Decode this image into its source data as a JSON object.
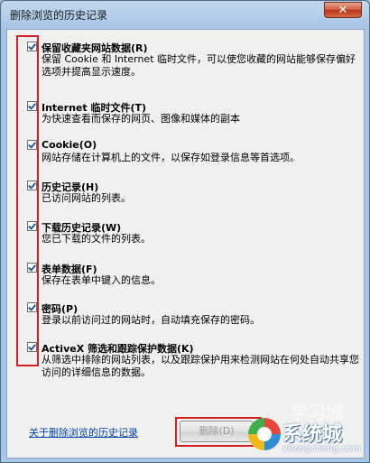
{
  "window": {
    "title": "删除浏览的历史记录",
    "close_label": "✕"
  },
  "items": [
    {
      "checked": true,
      "title": "保留收藏夹网站数据(R)",
      "desc": "保留 Cookie 和 Internet 临时文件，可以使您收藏的网站能够保存偏好选项并提高显示速度。"
    },
    {
      "checked": true,
      "title": "Internet 临时文件(T)",
      "desc": "为快速查看而保存的网页、图像和媒体的副本"
    },
    {
      "checked": true,
      "title": "Cookie(O)",
      "desc": "网站存储在计算机上的文件，以保存如登录信息等首选项。"
    },
    {
      "checked": true,
      "title": "历史记录(H)",
      "desc": "已访问网站的列表。"
    },
    {
      "checked": true,
      "title": "下载历史记录(W)",
      "desc": "您已下载的文件的列表。"
    },
    {
      "checked": true,
      "title": "表单数据(F)",
      "desc": "保存在表单中键入的信息。"
    },
    {
      "checked": true,
      "title": "密码(P)",
      "desc": "登录以前访问过的网站时，自动填充保存的密码。"
    },
    {
      "checked": true,
      "title": "ActiveX 筛选和跟踪保护数据(K)",
      "desc": "从筛选中排除的网站列表，以及跟踪保护用来检测网站在何处自动共享您访问的详细信息的数据。"
    }
  ],
  "footer": {
    "link_label": "关于删除浏览的历史记录",
    "delete_label": "删除(D)"
  },
  "watermark": {
    "brand": "系统城",
    "url": "xitongcheng.com",
    "faint": "学习城"
  }
}
